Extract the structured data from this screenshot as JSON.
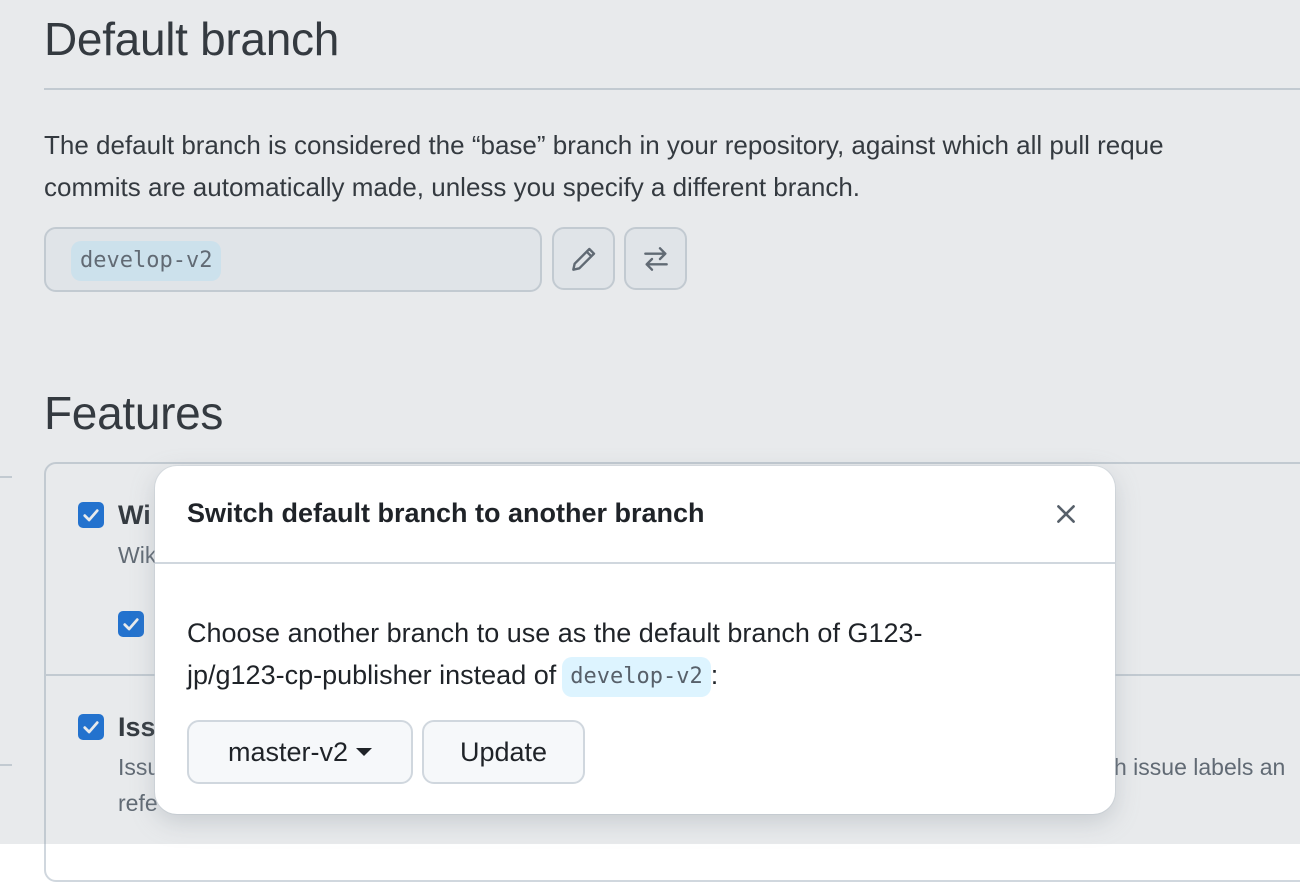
{
  "default_branch": {
    "title": "Default branch",
    "description_line1": "The default branch is considered the “base” branch in your repository, against which all pull reque",
    "description_line2": "commits are automatically made, unless you specify a different branch.",
    "current_branch": "develop-v2",
    "edit_icon": "pencil-icon",
    "switch_icon": "arrow-switch-icon"
  },
  "features": {
    "title": "Features",
    "items": [
      {
        "label": "Wi",
        "sub": "Wik",
        "checked": true
      },
      {
        "label": "Iss",
        "sub_left": "Issu",
        "sub_right": "h issue labels an",
        "sub2": "refe",
        "checked": true
      }
    ],
    "sub_option_checked": true
  },
  "dialog": {
    "title": "Switch default branch to another branch",
    "body_line1": "Choose another branch to use as the default branch of G123-",
    "body_line2": "jp/g123-cp-publisher instead of",
    "current_branch": "develop-v2",
    "body_suffix": ":",
    "branch_select": "master-v2",
    "update_label": "Update",
    "close_icon": "x-icon"
  },
  "colors": {
    "accent": "#0969da",
    "code_bg": "#ddf4ff",
    "border": "#d0d7de"
  }
}
